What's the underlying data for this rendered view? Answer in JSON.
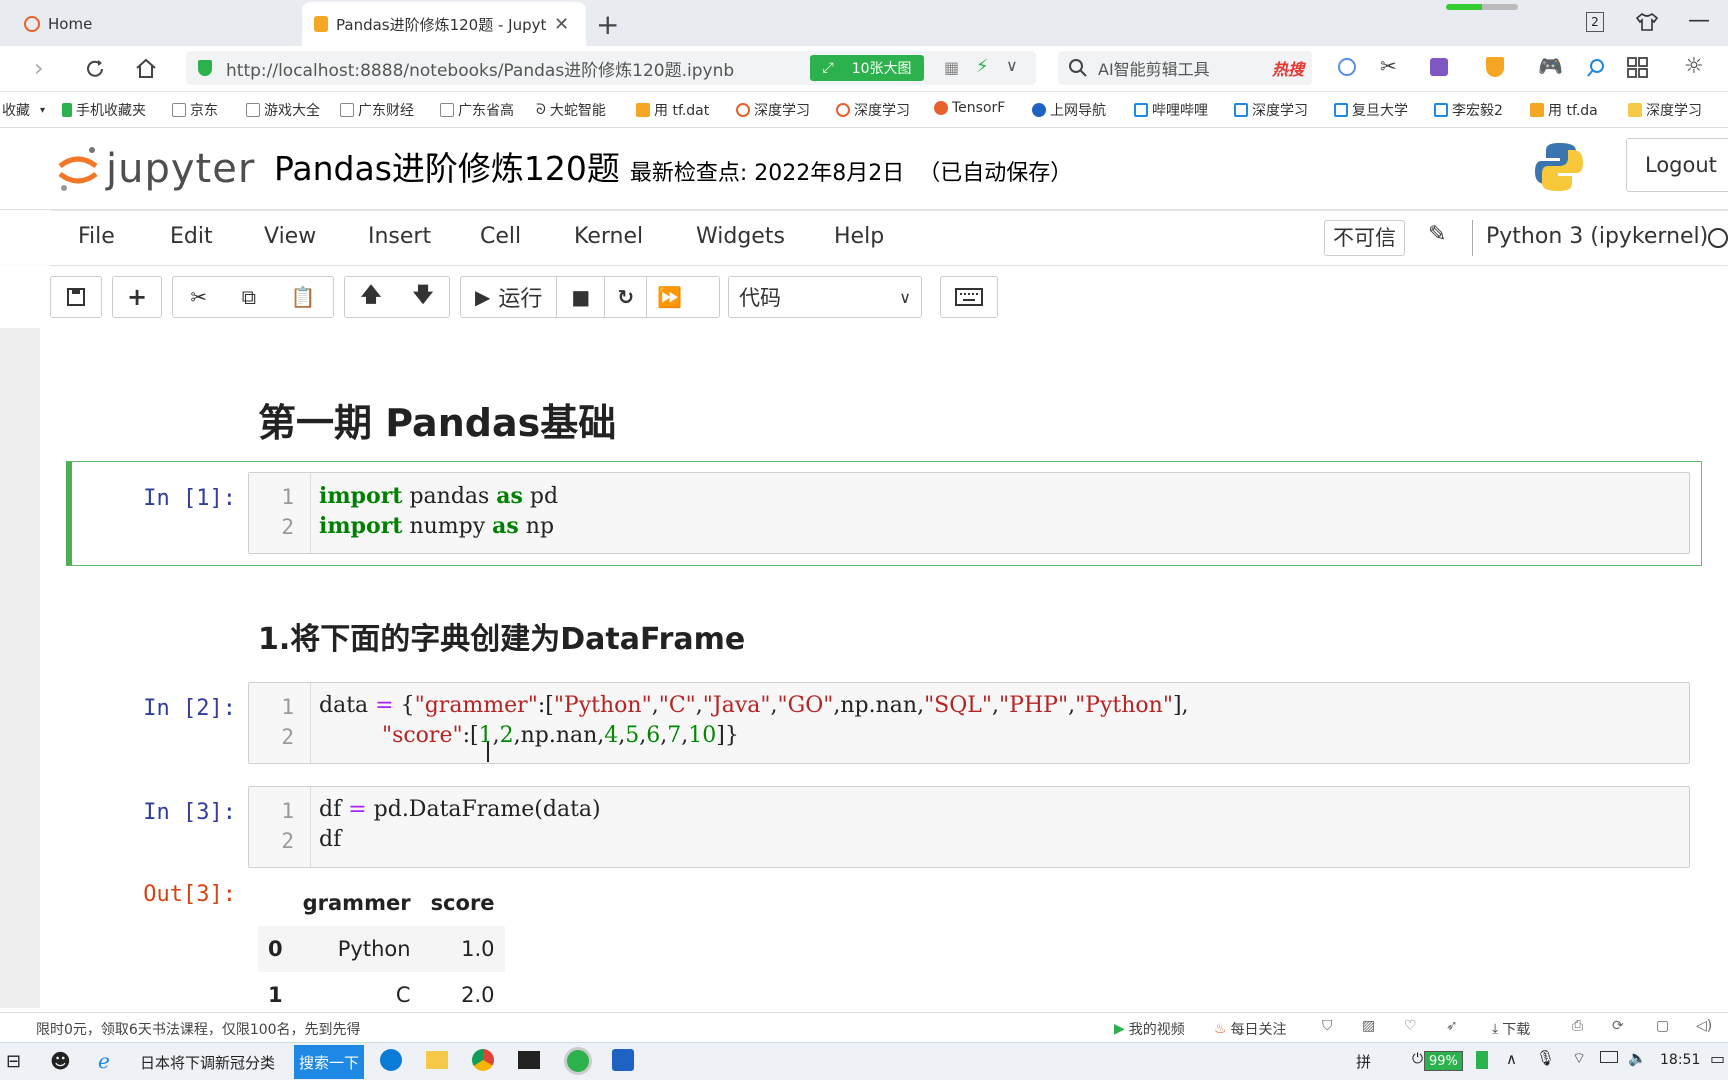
{
  "browser": {
    "tabs": [
      {
        "label": "Home"
      },
      {
        "label": "Pandas进阶修炼120题 - Jupyte"
      }
    ],
    "new_tab": "+",
    "url": "http://localhost:8888/notebooks/Pandas进阶修炼120题.ipynb",
    "url_host": "localhost",
    "badge": "10张大图",
    "search_placeholder": "AI智能剪辑工具",
    "hot": "热搜",
    "bookmarks": [
      "收藏",
      "手机收藏夹",
      "京东",
      "游戏大全",
      "广东财经",
      "广东省高",
      "大蛇智能",
      "用 tf.dat",
      "深度学习",
      "深度学习",
      "TensorF",
      "上网导航",
      "哔哩哔哩",
      "深度学习",
      "复旦大学",
      "李宏毅2",
      "用 tf.da",
      "深度学习"
    ],
    "window_count": "2"
  },
  "jupyter": {
    "logo": "jupyter",
    "notebook_title": "Pandas进阶修炼120题",
    "checkpoint": "最新检查点: 2022年8月2日",
    "autosave": "（已自动保存）",
    "logout": "Logout",
    "menus": [
      "File",
      "Edit",
      "View",
      "Insert",
      "Cell",
      "Kernel",
      "Widgets",
      "Help"
    ],
    "trust": "不可信",
    "kernel": "Python 3 (ipykernel)",
    "run_label": "运行",
    "cell_type": "代码"
  },
  "cells": {
    "heading1": "第一期 Pandas基础",
    "cell1": {
      "prompt": "In  [1]:",
      "lines": [
        "import pandas as pd",
        "import numpy as np"
      ]
    },
    "heading2": "1.将下面的字典创建为DataFrame",
    "cell2": {
      "prompt": "In  [2]:",
      "line1": "data = {\"grammer\":[\"Python\",\"C\",\"Java\",\"GO\",np.nan,\"SQL\",\"PHP\",\"Python\"],",
      "line2": "         \"score\":[1,2,np.nan,4,5,6,7,10]}"
    },
    "cell3": {
      "prompt": "In  [3]:",
      "lines": [
        "df = pd.DataFrame(data)",
        "df"
      ]
    },
    "out3": {
      "prompt": "Out[3]:",
      "columns": [
        "grammer",
        "score"
      ],
      "rows": [
        [
          "0",
          "Python",
          "1.0"
        ],
        [
          "1",
          "C",
          "2.0"
        ]
      ]
    }
  },
  "status": {
    "promo": "限时0元，领取6天书法课程，仅限100名，先到先得",
    "my_video": "我的视频",
    "daily": "每日关注",
    "download": "下载"
  },
  "taskbar": {
    "news": "日本将下调新冠分类",
    "search_btn": "搜索一下",
    "ime": "拼",
    "battery": "99%",
    "time": "18:51"
  }
}
